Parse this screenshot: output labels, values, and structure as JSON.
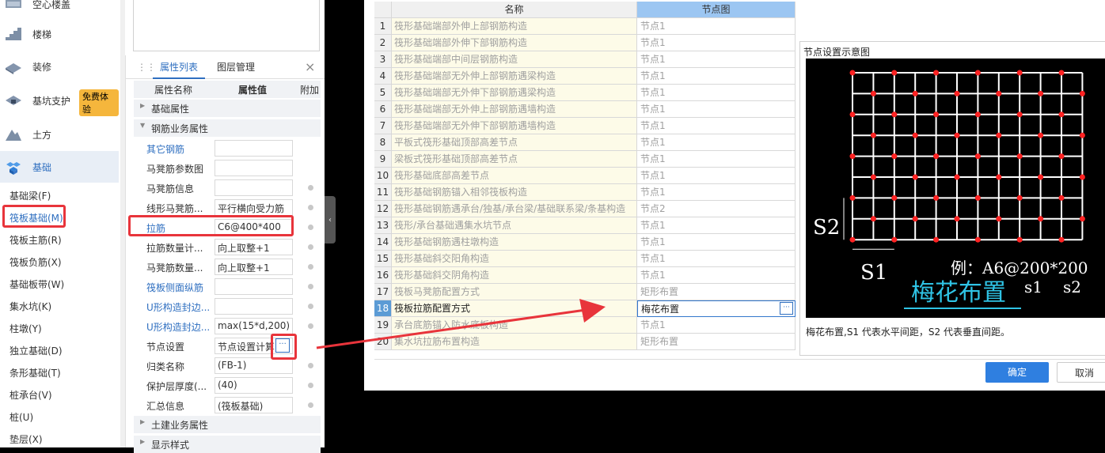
{
  "nav": {
    "categories": [
      {
        "label": "空心楼盖",
        "icon": "hollow-floor-icon"
      },
      {
        "label": "楼梯",
        "icon": "stairs-icon"
      },
      {
        "label": "装修",
        "icon": "decoration-icon"
      },
      {
        "label": "基坑支护",
        "icon": "excavation-icon"
      },
      {
        "label": "土方",
        "icon": "earthwork-icon"
      },
      {
        "label": "基础",
        "icon": "foundation-icon"
      }
    ],
    "badge": "免费体验",
    "subitems": [
      "基础梁(F)",
      "筏板基础(M)",
      "筏板主筋(R)",
      "筏板负筋(X)",
      "基础板带(W)",
      "集水坑(K)",
      "柱墩(Y)",
      "独立基础(D)",
      "条形基础(T)",
      "桩承台(V)",
      "桩(U)",
      "垫层(X)"
    ]
  },
  "panel": {
    "tab_props": "属性列表",
    "tab_layers": "图层管理",
    "close": "×",
    "col_name": "属性名称",
    "col_value": "属性值",
    "col_extra": "附加",
    "group_basic": "基础属性",
    "group_rebar": "钢筋业务属性",
    "group_civil": "土建业务属性",
    "group_display": "显示样式",
    "rows": [
      {
        "name": "其它钢筋",
        "value": ""
      },
      {
        "name": "马凳筋参数图",
        "value": ""
      },
      {
        "name": "马凳筋信息",
        "value": ""
      },
      {
        "name": "线形马凳筋...",
        "value": "平行横向受力筋"
      },
      {
        "name": "拉筋",
        "value": "C6@400*400"
      },
      {
        "name": "拉筋数量计...",
        "value": "向上取整+1"
      },
      {
        "name": "马凳筋数量...",
        "value": "向上取整+1"
      },
      {
        "name": "筏板侧面纵筋",
        "value": ""
      },
      {
        "name": "U形构造封边...",
        "value": ""
      },
      {
        "name": "U形构造封边...",
        "value": "max(15*d,200)"
      },
      {
        "name": "节点设置",
        "value": "节点设置计算"
      },
      {
        "name": "归类名称",
        "value": "(FB-1)"
      },
      {
        "name": "保护层厚度(...",
        "value": "(40)"
      },
      {
        "name": "汇总信息",
        "value": "(筏板基础)"
      }
    ],
    "ellipsis": "···"
  },
  "dialog": {
    "col_name": "名称",
    "col_node": "节点图",
    "rows": [
      {
        "num": "1",
        "name": "筏形基础端部外伸上部钢筋构造",
        "node": "节点1"
      },
      {
        "num": "2",
        "name": "筏形基础端部外伸下部钢筋构造",
        "node": "节点1"
      },
      {
        "num": "3",
        "name": "筏形基础端部中间层钢筋构造",
        "node": "节点1"
      },
      {
        "num": "4",
        "name": "筏形基础端部无外伸上部钢筋遇梁构造",
        "node": "节点1"
      },
      {
        "num": "5",
        "name": "筏形基础端部无外伸下部钢筋遇梁构造",
        "node": "节点1"
      },
      {
        "num": "6",
        "name": "筏形基础端部无外伸上部钢筋遇墙构造",
        "node": "节点1"
      },
      {
        "num": "7",
        "name": "筏形基础端部无外伸下部钢筋遇墙构造",
        "node": "节点1"
      },
      {
        "num": "8",
        "name": "平板式筏形基础顶部高差节点",
        "node": "节点1"
      },
      {
        "num": "9",
        "name": "梁板式筏形基础顶部高差节点",
        "node": "节点1"
      },
      {
        "num": "10",
        "name": "筏形基础底部高差节点",
        "node": "节点1"
      },
      {
        "num": "11",
        "name": "筏形基础钢筋锚入相邻筏板构造",
        "node": "节点1"
      },
      {
        "num": "12",
        "name": "筏形基础钢筋遇承台/独基/承台梁/基础联系梁/条基构造",
        "node": "节点2"
      },
      {
        "num": "13",
        "name": "筏形/承台基础遇集水坑节点",
        "node": "节点1"
      },
      {
        "num": "14",
        "name": "筏形基础钢筋遇柱墩构造",
        "node": "节点1"
      },
      {
        "num": "15",
        "name": "筏形基础斜交阳角构造",
        "node": "节点1"
      },
      {
        "num": "16",
        "name": "筏形基础斜交阴角构造",
        "node": "节点1"
      },
      {
        "num": "17",
        "name": "筏板马凳筋配置方式",
        "node": "矩形布置"
      },
      {
        "num": "18",
        "name": "筏板拉筋配置方式",
        "node": "梅花布置"
      },
      {
        "num": "19",
        "name": "承台底筋锚入防水底板构造",
        "node": "节点1"
      },
      {
        "num": "20",
        "name": "集水坑拉筋布置构造",
        "node": "矩形布置"
      }
    ],
    "preview_title": "节点设置示意图",
    "preview_desc": "梅花布置,S1 代表水平间距，S2 代表垂直间距。",
    "diagram": {
      "s2": "S2",
      "s1": "S1",
      "example": "例：A6@200*200",
      "title": "梅花布置",
      "s1_small": "s1",
      "s2_small": "s2",
      "line_color": "#ffffff",
      "dot_color": "#ff2222",
      "title_color": "#2fc4e6"
    },
    "ok": "确定",
    "cancel": "取消"
  }
}
